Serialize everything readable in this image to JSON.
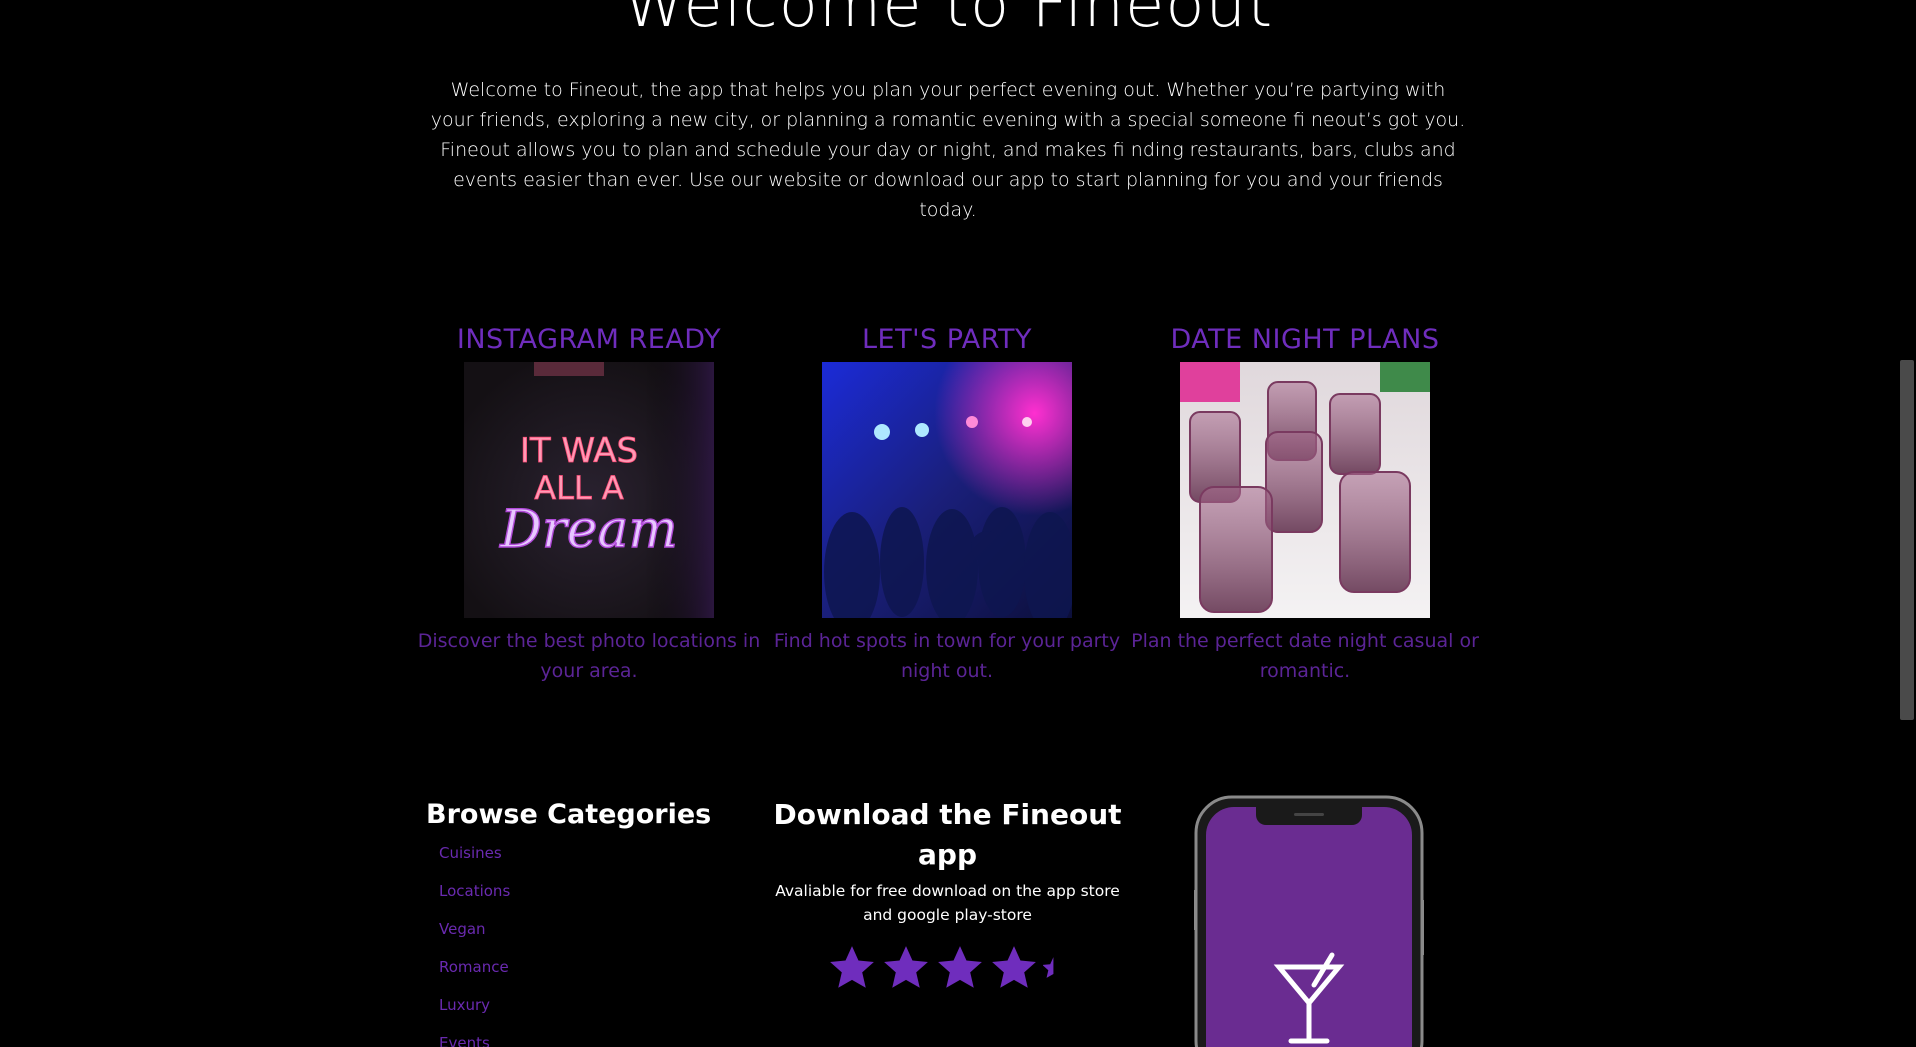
{
  "hero": {
    "title": "Welcome to Fineout",
    "intro": "Welcome to Fineout, the app that helps you plan your perfect evening out. Whether you’re partying with your friends, exploring a new city, or planning a romantic evening with a special someone fi neout’s got you. Fineout allows you to plan and schedule your day or night, and makes fi nding restaurants, bars, clubs and events easier than ever. Use our website or download our app to start planning for you and your friends today."
  },
  "features": [
    {
      "title": "INSTAGRAM READY",
      "image_sign_lines": [
        "IT WAS",
        "ALL A",
        "Dream"
      ],
      "description": "Discover the best photo locations in your area."
    },
    {
      "title": "LET'S PARTY",
      "description": "Find hot spots in town for your party night out."
    },
    {
      "title": "DATE NIGHT PLANS",
      "description": "Plan the perfect date night casual or romantic."
    }
  ],
  "browse": {
    "title": "Browse Categories",
    "items": [
      "Cuisines",
      "Locations",
      "Vegan",
      "Romance",
      "Luxury",
      "Events"
    ]
  },
  "download": {
    "title": "Download the Fineout app",
    "subtitle": "Avaliable for free download on the app store and google play-store",
    "rating": 4.5,
    "max_rating": 5
  },
  "colors": {
    "accent": "#6f2dbd",
    "accent_dark": "#5b2496",
    "background": "#000000",
    "phone_screen": "#6a2c91"
  },
  "icons": {
    "star": "star-icon",
    "cocktail": "cocktail-glass-icon"
  }
}
